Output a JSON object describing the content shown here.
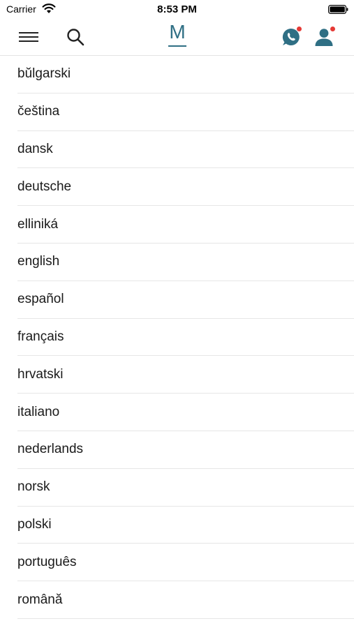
{
  "status_bar": {
    "carrier": "Carrier",
    "time": "8:53 PM"
  },
  "header": {
    "logo_text": "M",
    "menu_icon": "hamburger-menu-icon",
    "search_icon": "search-icon",
    "whatsapp_icon": "whatsapp-icon",
    "account_icon": "user-icon",
    "accent_color": "#2f6f84",
    "notification_color": "#e53935"
  },
  "languages": [
    "bŭlgarski",
    "čeština",
    "dansk",
    "deutsche",
    "elliniká",
    "english",
    "español",
    "français",
    "hrvatski",
    "italiano",
    "nederlands",
    "norsk",
    "polski",
    "português",
    "română"
  ]
}
